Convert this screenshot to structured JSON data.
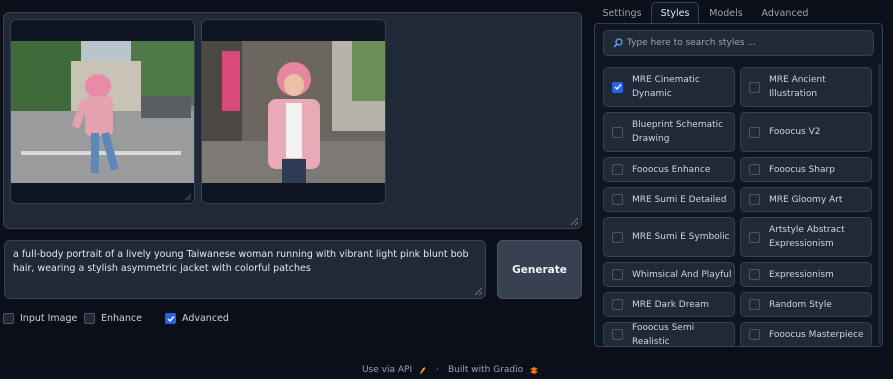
{
  "gallery": {
    "images": [
      {
        "alt_name": "generated-image-1"
      },
      {
        "alt_name": "generated-image-2"
      }
    ]
  },
  "prompt": {
    "value": "a full-body portrait of a lively young Taiwanese woman running with vibrant light pink blunt bob hair, wearing a stylish asymmetric jacket with colorful patches"
  },
  "generate_label": "Generate",
  "options": {
    "input_image": {
      "label": "Input Image",
      "checked": false
    },
    "enhance": {
      "label": "Enhance",
      "checked": false
    },
    "advanced": {
      "label": "Advanced",
      "checked": true
    }
  },
  "tabs": [
    "Settings",
    "Styles",
    "Models",
    "Advanced"
  ],
  "active_tab": "Styles",
  "search": {
    "placeholder": "Type here to search styles ..."
  },
  "styles": [
    {
      "label": "MRE Cinematic Dynamic",
      "checked": true
    },
    {
      "label": "MRE Ancient Illustration",
      "checked": false
    },
    {
      "label": "Blueprint Schematic Drawing",
      "checked": false
    },
    {
      "label": "Fooocus V2",
      "checked": false
    },
    {
      "label": "Fooocus Enhance",
      "checked": false
    },
    {
      "label": "Fooocus Sharp",
      "checked": false
    },
    {
      "label": "MRE Sumi E Detailed",
      "checked": false
    },
    {
      "label": "MRE Gloomy Art",
      "checked": false
    },
    {
      "label": "MRE Sumi E Symbolic",
      "checked": false
    },
    {
      "label": "Artstyle Abstract Expressionism",
      "checked": false
    },
    {
      "label": "Whimsical And Playful",
      "checked": false
    },
    {
      "label": "Expressionism",
      "checked": false
    },
    {
      "label": "MRE Dark Dream",
      "checked": false
    },
    {
      "label": "Random Style",
      "checked": false
    },
    {
      "label": "Fooocus Semi Realistic",
      "checked": false
    },
    {
      "label": "Fooocus Masterpiece",
      "checked": false
    }
  ],
  "footer": {
    "api_label": "Use via API",
    "separator": "·",
    "built_label": "Built with Gradio"
  },
  "colors": {
    "accent": "#2563eb",
    "background": "#0b0f19",
    "panel": "#1f2937"
  }
}
